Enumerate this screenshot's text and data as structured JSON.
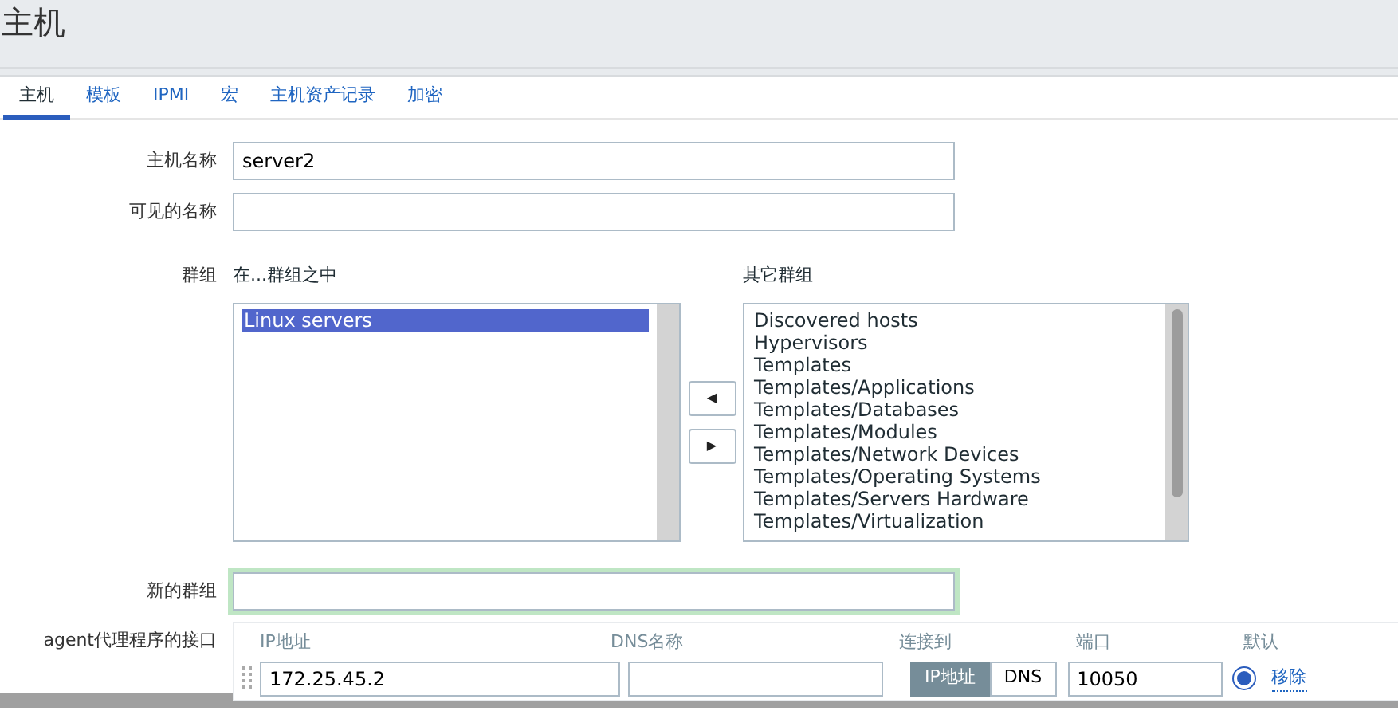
{
  "page_title": "主机",
  "tabs": [
    {
      "label": "主机",
      "selected": true
    },
    {
      "label": "模板",
      "selected": false
    },
    {
      "label": "IPMI",
      "selected": false
    },
    {
      "label": "宏",
      "selected": false
    },
    {
      "label": "主机资产记录",
      "selected": false
    },
    {
      "label": "加密",
      "selected": false
    }
  ],
  "host_name": {
    "label": "主机名称",
    "value": "server2"
  },
  "visible_name": {
    "label": "可见的名称"
  },
  "groups": {
    "label": "群组",
    "in_groups_label": "在...群组之中",
    "other_groups_label": "其它群组",
    "in_groups": [
      {
        "label": "Linux servers",
        "selected": true
      }
    ],
    "other_groups": [
      {
        "label": "Discovered hosts",
        "selected": false
      },
      {
        "label": "Hypervisors",
        "selected": false
      },
      {
        "label": "Templates",
        "selected": false
      },
      {
        "label": "Templates/Applications",
        "selected": false
      },
      {
        "label": "Templates/Databases",
        "selected": false
      },
      {
        "label": "Templates/Modules",
        "selected": false
      },
      {
        "label": "Templates/Network Devices",
        "selected": false
      },
      {
        "label": "Templates/Operating Systems",
        "selected": false
      },
      {
        "label": "Templates/Servers Hardware",
        "selected": false
      },
      {
        "label": "Templates/Virtualization",
        "selected": false
      }
    ],
    "move_left": "◀",
    "move_right": "▶"
  },
  "new_group": {
    "label": "新的群组",
    "focused": true
  },
  "agent_interfaces": {
    "label": "agent代理程序的接口",
    "columns": [
      "IP地址",
      "DNS名称",
      "连接到",
      "端口",
      "默认"
    ],
    "rows": [
      {
        "ip": "172.25.45.2",
        "connect_options": [
          {
            "label": "IP地址",
            "selected": true
          },
          {
            "label": "DNS",
            "selected": false
          }
        ],
        "port": "10050",
        "default": true,
        "remove": "移除"
      }
    ]
  }
}
